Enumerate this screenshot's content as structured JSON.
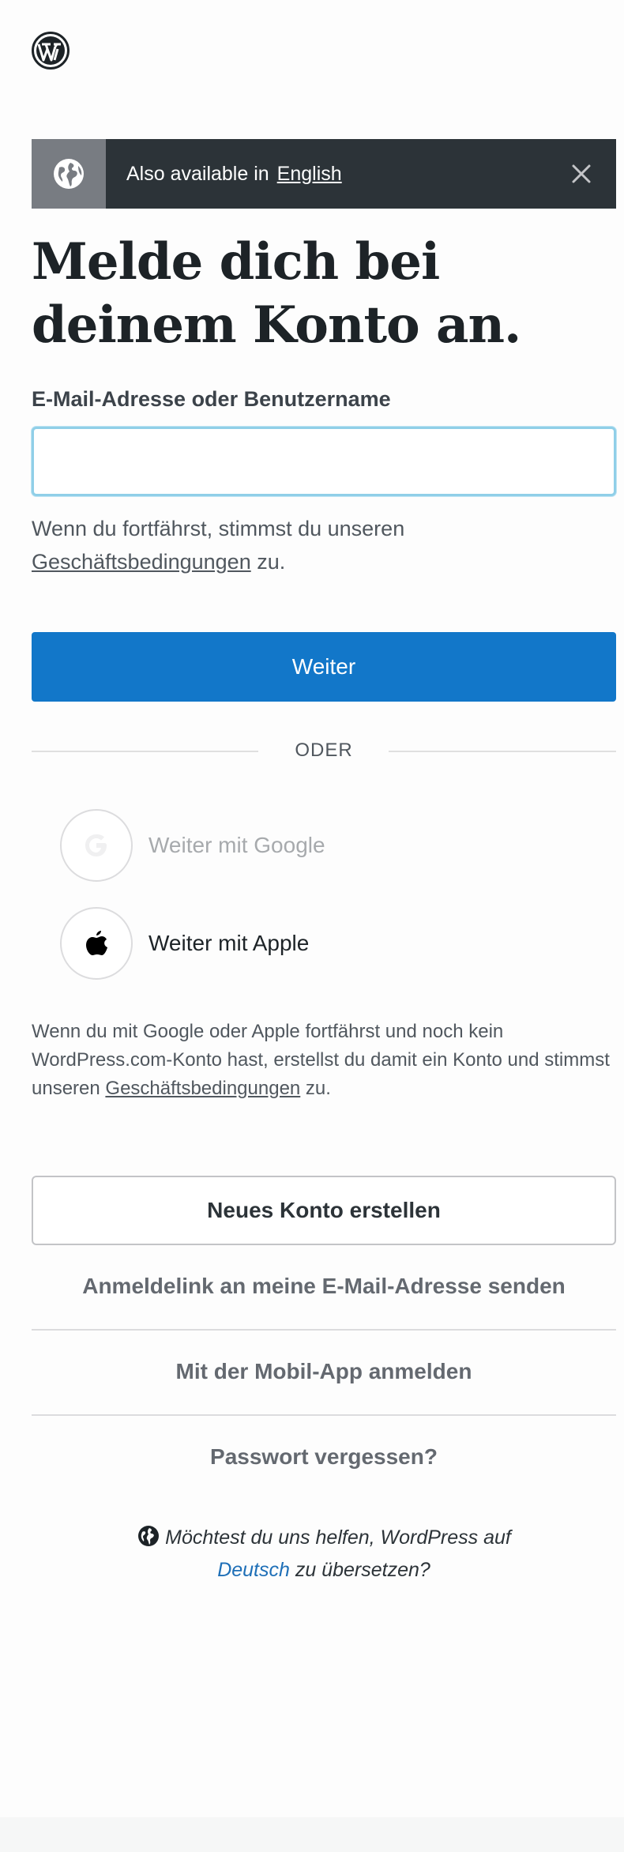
{
  "notice": {
    "prefix": "Also available in",
    "language_link": "English",
    "icons": {
      "globe": "globe-icon",
      "close": "close-icon"
    }
  },
  "heading": "Melde dich bei deinem Konto an.",
  "form": {
    "label": "E-Mail-Adresse oder Benutzername",
    "value": "",
    "placeholder": ""
  },
  "tos": {
    "prefix": "Wenn du fortfährst, stimmst du unseren",
    "link": "Geschäftsbedingungen",
    "suffix": " zu."
  },
  "primary_button": "Weiter",
  "divider": "ODER",
  "social": {
    "google": "Weiter mit Google",
    "apple": "Weiter mit Apple"
  },
  "social_note": {
    "text": "Wenn du mit Google oder Apple fortfährst und noch kein WordPress.com-Konto hast, erstellst du damit ein Konto und stimmst unseren ",
    "link": "Geschäftsbedingungen",
    "suffix": " zu."
  },
  "create_account": "Neues Konto erstellen",
  "links": {
    "magic_link": "Anmeldelink an meine E-Mail-Adresse senden",
    "mobile_app": "Mit der Mobil-App anmelden",
    "forgot": "Passwort vergessen?"
  },
  "translate": {
    "line1": "Möchtest du uns helfen, WordPress auf",
    "language": "Deutsch",
    "line2_suffix": " zu übersetzen?"
  },
  "colors": {
    "primary": "#1277c9",
    "notice_bg": "#2c3338",
    "notice_icon_bg": "#787c82",
    "input_focus": "#90cfe8",
    "link_blue": "#1e6fb7"
  }
}
